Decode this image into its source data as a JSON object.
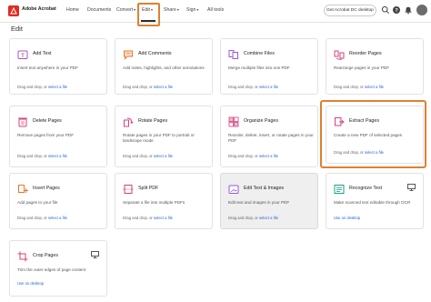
{
  "nav": {
    "brand": "Adobe Acrobat",
    "home": "Home",
    "documents": "Documents",
    "convert": "Convert",
    "edit": "Edit",
    "share": "Share",
    "sign": "Sign",
    "all_tools": "All tools",
    "get_desktop": "Get Acrobat DC desktop"
  },
  "page": {
    "title": "Edit"
  },
  "cards": {
    "add_text": {
      "title": "Add Text",
      "desc": "Insert text anywhere in your PDF",
      "drag": "Drag and drop, or ",
      "link": "select a file"
    },
    "add_comments": {
      "title": "Add Comments",
      "desc": "Add notes, highlights, and other annotations",
      "drag": "Drag and drop, or ",
      "link": "select a file"
    },
    "combine_files": {
      "title": "Combine Files",
      "desc": "Merge multiple files into one PDF",
      "drag": "Drag and drop, or ",
      "link": "select a file"
    },
    "reorder_pages": {
      "title": "Reorder Pages",
      "desc": "Rearrange pages in your PDF",
      "drag": "Drag and drop, or ",
      "link": "select a file"
    },
    "delete_pages": {
      "title": "Delete Pages",
      "desc": "Remove pages from your PDF",
      "drag": "Drag and drop, or ",
      "link": "select a file"
    },
    "rotate_pages": {
      "title": "Rotate Pages",
      "desc": "Rotate pages in your PDF to portrait or landscape mode",
      "drag": "Drag and drop, or ",
      "link": "select a file"
    },
    "organize_pages": {
      "title": "Organize Pages",
      "desc": "Reorder, delete, insert, or rotate pages in your PDF",
      "drag": "Drag and drop, or ",
      "link": "select a file"
    },
    "extract_pages": {
      "title": "Extract Pages",
      "desc": "Create a new PDF of selected pages",
      "drag": "Drag and drop, or ",
      "link": "select a file"
    },
    "insert_pages": {
      "title": "Insert Pages",
      "desc": "Add pages to your file",
      "drag": "Drag and drop, or ",
      "link": "select a file"
    },
    "split_pdf": {
      "title": "Split PDF",
      "desc": "Separate a file into multiple PDFs",
      "drag": "Drag and drop, or ",
      "link": "select a file"
    },
    "edit_text_images": {
      "title": "Edit Text & Images",
      "desc": "Edit text and images in your PDF",
      "drag": "Drag and drop, or ",
      "link": "select a file"
    },
    "recognize_text": {
      "title": "Recognize Text",
      "desc": "Make scanned text editable through OCR",
      "link": "Use on desktop"
    },
    "crop_pages": {
      "title": "Crop Pages",
      "desc": "Trim the outer edges of page content",
      "link": "Use on desktop"
    }
  },
  "colors": {
    "brand_red": "#e22b21",
    "highlight_orange": "#e0802f",
    "link_blue": "#2a65d3",
    "icon_purple": "#9b58d8",
    "icon_orange": "#e8762d",
    "icon_pink": "#d6407d",
    "icon_teal": "#17a08c"
  }
}
